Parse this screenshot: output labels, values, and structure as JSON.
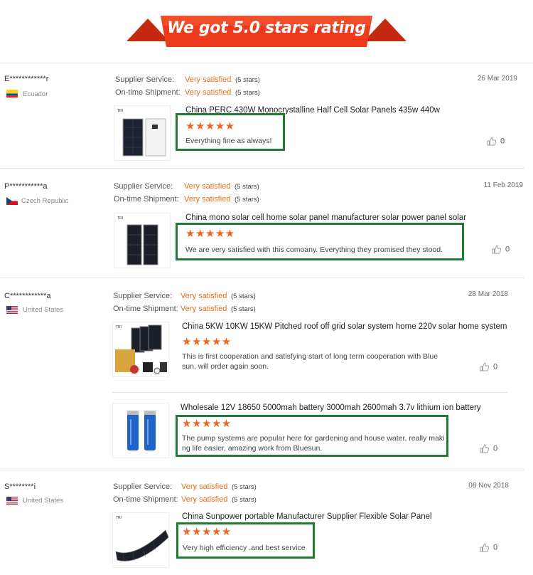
{
  "banner": {
    "title": "We got 5.0 stars rating"
  },
  "colors": {
    "accent": "#e8701a",
    "star": "#f2641f",
    "highlight": "#1f7a33",
    "banner": "#ee3a1c"
  },
  "labels": {
    "supplier_service": "Supplier Service:",
    "ontime_shipment": "On-time Shipment:",
    "very_satisfied": "Very satisfied",
    "five_stars": "(5 stars)",
    "star_glyphs": "★★★★★"
  },
  "reviews": [
    {
      "name": "E************r",
      "country": "Ecuador",
      "date": "26 Mar 2019",
      "products": [
        {
          "title": "China PERC 430W Monocrystalline Half Cell Solar Panels 435w 440w",
          "rating": 5,
          "comment": "Everything fine as always!",
          "likes": "0"
        }
      ]
    },
    {
      "name": "P***********a",
      "country": "Czech Republic",
      "date": "11 Feb 2019",
      "products": [
        {
          "title": "China mono solar cell home solar panel manufacturer solar power panel solar",
          "rating": 5,
          "comment": "We are very satisfied with this comoany. Everything they promised they stood.",
          "likes": "0"
        }
      ]
    },
    {
      "name": "C************a",
      "country": "United States",
      "date": "28 Mar 2018",
      "products": [
        {
          "title": "China 5KW 10KW 15KW Pitched roof off grid solar system home 220v solar home system",
          "rating": 5,
          "comment_line1": "This is first cooperation and satisfying start of long term cooperation with Blue",
          "comment_line2": "sun, will order again soon.",
          "likes": "0"
        },
        {
          "title": "Wholesale 12V 18650 5000mah battery 3000mah 2600mah 3.7v lithium ion battery",
          "rating": 5,
          "comment_line1": "The pump systems are popular here for gardening and house water, really maki",
          "comment_line2": "ng life easier, amazing work from Bluesun.",
          "likes": "0"
        }
      ]
    },
    {
      "name": "S********i",
      "country": "United States",
      "date": "08 Nov 2018",
      "products": [
        {
          "title": "China Sunpower portable Manufacturer Supplier Flexible Solar Panel",
          "rating": 5,
          "comment": "Very high efficiency .and best service",
          "likes": "0"
        }
      ]
    }
  ]
}
